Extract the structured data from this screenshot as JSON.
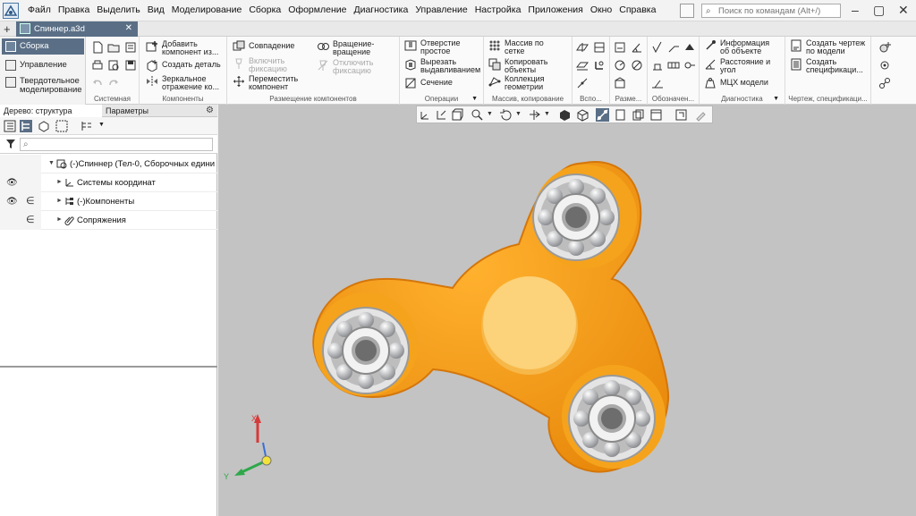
{
  "app": {
    "menu": [
      "Файл",
      "Правка",
      "Выделить",
      "Вид",
      "Моделирование",
      "Сборка",
      "Оформление",
      "Диагностика",
      "Управление",
      "Настройка",
      "Приложения",
      "Окно",
      "Справка"
    ],
    "search_placeholder": "Поиск по командам (Alt+/)",
    "document_tab": "Спиннер.a3d"
  },
  "modes": [
    "Сборка",
    "Управление",
    "Твердотельное моделирование"
  ],
  "ribbon": {
    "system": {
      "label": "Системная"
    },
    "components": {
      "label": "Компоненты",
      "add": "Добавить компонент из...",
      "create_part": "Создать деталь",
      "mirror": "Зеркальное отражение ко..."
    },
    "placement": {
      "label": "Размещение компонентов",
      "coincidence": "Совпадение",
      "enable_fix": "Включить фиксацию",
      "move": "Переместить компонент",
      "rotate": "Вращение-вращение",
      "disable_fix": "Отключить фиксацию"
    },
    "operations": {
      "label": "Операции",
      "hole": "Отверстие простое",
      "cut_extrude": "Вырезать выдавливанием",
      "section": "Сечение"
    },
    "arrays": {
      "label": "Массив, копирование",
      "grid": "Массив по сетке",
      "copy": "Копировать объекты",
      "collection": "Коллекция геометрии"
    },
    "aux": {
      "label": "Вспо..."
    },
    "dims": {
      "label": "Разме..."
    },
    "marks": {
      "label": "Обозначен..."
    },
    "diagnostics": {
      "label": "Диагностика",
      "info": "Информация об объекте",
      "distance": "Расстояние и угол",
      "mch": "МЦХ модели"
    },
    "drawing": {
      "label": "Чертеж, спецификаци...",
      "create_drawing": "Создать чертеж по модели",
      "create_spec": "Создать спецификаци..."
    }
  },
  "panel": {
    "tab_tree": "Дерево: структура",
    "tab_params": "Параметры",
    "tree": [
      {
        "label": "(-)Спиннер (Тел-0, Сборочных едини"
      },
      {
        "label": "Системы координат"
      },
      {
        "label": "(-)Компоненты"
      },
      {
        "label": "Сопряжения"
      }
    ]
  },
  "axes": {
    "x": "X",
    "y": "Y"
  },
  "colors": {
    "accent": "#5a6f86",
    "body": "#f5a31c",
    "center": "#fcd27a",
    "viewport": "#c3c3c3"
  }
}
